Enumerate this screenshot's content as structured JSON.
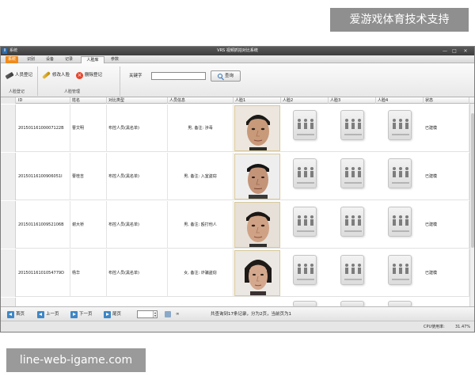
{
  "watermark_top": "爱游戏体育技术支持",
  "watermark_bottom": "line-web-igame.com",
  "window": {
    "system_label": "系统",
    "title": "VRS 视频抓拍对比系统",
    "minimize_symbol": "—",
    "maximize_symbol": "□",
    "close_symbol": "✕"
  },
  "tabs": [
    {
      "label": "系统"
    },
    {
      "label": "识别"
    },
    {
      "label": "设备"
    },
    {
      "label": "记录"
    },
    {
      "label": "人脸库"
    },
    {
      "label": "参数"
    }
  ],
  "active_tab": "人脸库",
  "ribbon": {
    "register_label": "人员登记",
    "modify_label": "修改人脸",
    "delete_label": "删除登记",
    "group1_label": "人脸登记",
    "group2_label": "人脸管理",
    "keyword_label": "关键字",
    "keyword_value": "",
    "query_label": "查询"
  },
  "table": {
    "headers": {
      "id": "ID",
      "name": "姓名",
      "type": "对比类型",
      "info": "人员信息",
      "face1": "人脸1",
      "face2": "人脸2",
      "face3": "人脸3",
      "face4": "人脸4",
      "status": "状态"
    },
    "rows": [
      {
        "id": "20150116100007122B",
        "name": "曹文明",
        "type": "布控人员(黑名单)",
        "info": "男, 备注: 涉毒",
        "status": "已建模"
      },
      {
        "id": "20150116100906051I",
        "name": "曹桂吉",
        "type": "布控人员(黑名单)",
        "info": "男, 备注: 入室盗窃",
        "status": "已建模"
      },
      {
        "id": "20150116100952106B",
        "name": "谢大桥",
        "type": "布控人员(黑名单)",
        "info": "男, 备注: 殴打他人",
        "status": "已建模"
      },
      {
        "id": "20150116101054779D",
        "name": "杨华",
        "type": "布控人员(黑名单)",
        "info": "女, 备注: 诈骗盗窃",
        "status": "已建模"
      }
    ]
  },
  "pager": {
    "first": "首页",
    "prev": "上一页",
    "next": "下一页",
    "last": "尾页",
    "page_value": "",
    "go_text": "∞",
    "info": "共查询到17条记录，分为2页，当前页为1"
  },
  "status_bar": {
    "cpu_label": "CPU使用率:",
    "cpu_value": "31.47%"
  },
  "colors": {
    "system_tab": "#f08a1c",
    "arrow_blue": "#3d86c6",
    "titlebar": "#4a4a4a"
  },
  "icons": {
    "face_placeholder": "people-placeholder-icon",
    "query": "search-icon"
  }
}
